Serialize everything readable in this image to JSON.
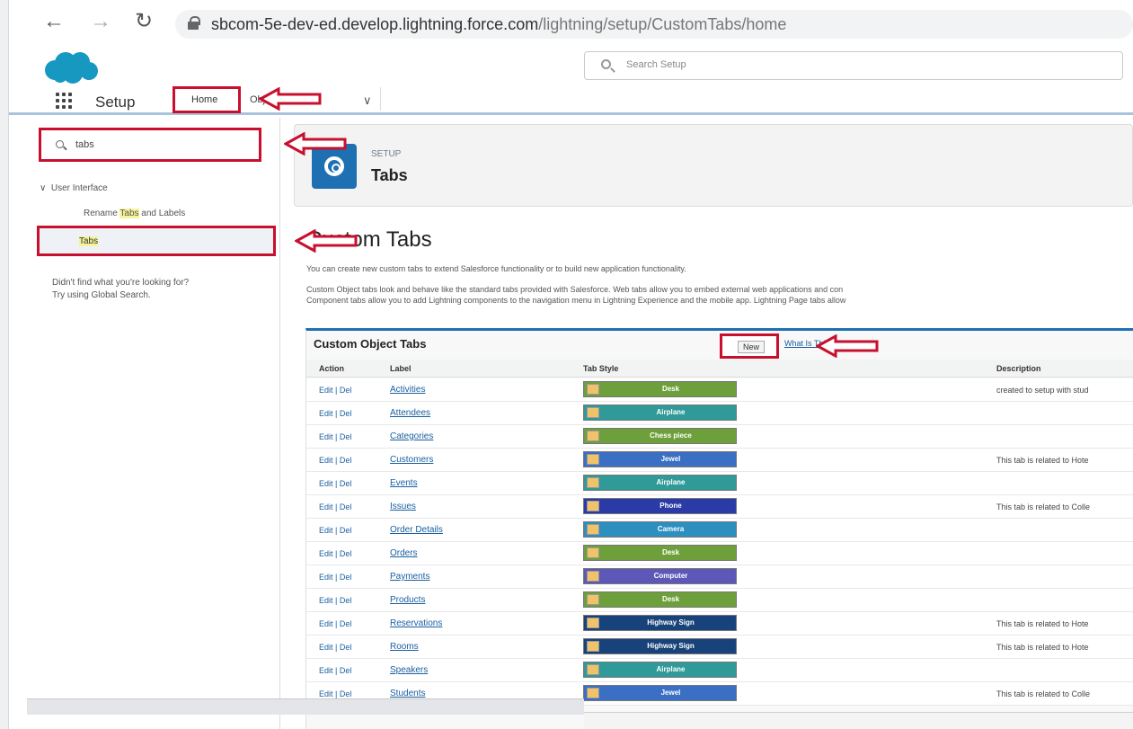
{
  "browser": {
    "url_host": "sbcom-5e-dev-ed.develop.lightning.force.com",
    "url_path": "/lightning/setup/CustomTabs/home"
  },
  "header": {
    "search_placeholder": "Search Setup"
  },
  "navbar": {
    "app_name": "Setup",
    "tab_home": "Home",
    "tab_object_manager": "Object Manager"
  },
  "sidebar": {
    "quick_find_value": "tabs",
    "section": "User Interface",
    "item_rename_prefix": "Rename ",
    "item_rename_hl": "Tabs",
    "item_rename_suffix": " and Labels",
    "item_tabs": "Tabs",
    "not_found_line1": "Didn't find what you're looking for?",
    "not_found_line2": "Try using Global Search."
  },
  "page_header": {
    "eyebrow": "SETUP",
    "title": "Tabs"
  },
  "main": {
    "title": "Custom Tabs",
    "desc1": "You can create new custom tabs to extend Salesforce functionality or to build new application functionality.",
    "desc2": "Custom Object tabs look and behave like the standard tabs provided with Salesforce. Web tabs allow you to embed external web applications and con",
    "desc3": "Component tabs allow you to add Lightning components to the navigation menu in Lightning Experience and the mobile app. Lightning Page tabs allow"
  },
  "table": {
    "title": "Custom Object Tabs",
    "new_button": "New",
    "help_link": "What Is This?",
    "headers": [
      "Action",
      "Label",
      "Tab Style",
      "Description"
    ],
    "action_text": "Edit | Del",
    "rows": [
      {
        "label": "Activities",
        "style": "Desk",
        "color": "#6da03a",
        "desc": "created to setup with stud"
      },
      {
        "label": "Attendees",
        "style": "Airplane",
        "color": "#2f9a97",
        "desc": ""
      },
      {
        "label": "Categories",
        "style": "Chess piece",
        "color": "#6da03a",
        "desc": ""
      },
      {
        "label": "Customers",
        "style": "Jewel",
        "color": "#3a6fc4",
        "desc": "This tab is related to Hote"
      },
      {
        "label": "Events",
        "style": "Airplane",
        "color": "#2f9a97",
        "desc": ""
      },
      {
        "label": "Issues",
        "style": "Phone",
        "color": "#2a3aa6",
        "desc": "This tab is related to Colle"
      },
      {
        "label": "Order Details",
        "style": "Camera",
        "color": "#2c8fc0",
        "desc": ""
      },
      {
        "label": "Orders",
        "style": "Desk",
        "color": "#6da03a",
        "desc": ""
      },
      {
        "label": "Payments",
        "style": "Computer",
        "color": "#5d57b8",
        "desc": ""
      },
      {
        "label": "Products",
        "style": "Desk",
        "color": "#6da03a",
        "desc": ""
      },
      {
        "label": "Reservations",
        "style": "Highway Sign",
        "color": "#18437a",
        "desc": "This tab is related to Hote"
      },
      {
        "label": "Rooms",
        "style": "Highway Sign",
        "color": "#18437a",
        "desc": "This tab is related to Hote"
      },
      {
        "label": "Speakers",
        "style": "Airplane",
        "color": "#2f9a97",
        "desc": ""
      },
      {
        "label": "Students",
        "style": "Jewel",
        "color": "#3a6fc4",
        "desc": "This tab is related to Colle"
      }
    ]
  }
}
